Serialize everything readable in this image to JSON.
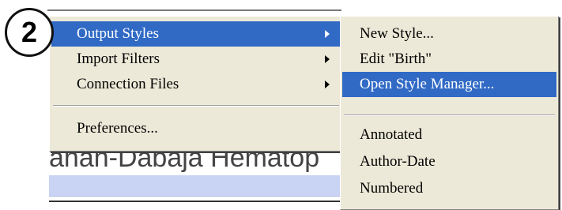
{
  "step_number": "2",
  "background": {
    "text": "ahan-Dabaja   Hematop"
  },
  "main_menu": {
    "items": [
      {
        "label": "Output Styles",
        "has_submenu": true,
        "active": true
      },
      {
        "label": "Import Filters",
        "has_submenu": true
      },
      {
        "label": "Connection Files",
        "has_submenu": true
      },
      {
        "label": "Preferences..."
      }
    ]
  },
  "sub_menu": {
    "items": [
      {
        "label": "New Style..."
      },
      {
        "label": "Edit \"Birth\""
      },
      {
        "label": "Open Style Manager...",
        "active": true
      },
      {
        "label": "Annotated"
      },
      {
        "label": "Author-Date"
      },
      {
        "label": "Numbered"
      }
    ]
  },
  "colors": {
    "menu_bg": "#ece9d8",
    "highlight": "#316ac5",
    "highlight_text": "#ffffff"
  }
}
